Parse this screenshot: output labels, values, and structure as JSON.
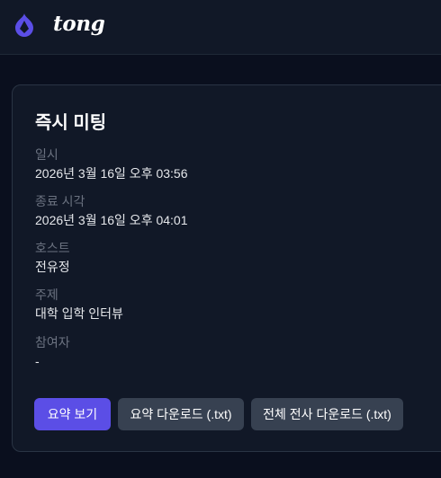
{
  "header": {
    "brand": "tong",
    "logo_color": "#5b4ee6"
  },
  "meeting": {
    "title": "즉시 미팅",
    "fields": [
      {
        "label": "일시",
        "value": "2026년 3월 16일 오후 03:56"
      },
      {
        "label": "종료 시각",
        "value": "2026년 3월 16일 오후 04:01"
      },
      {
        "label": "호스트",
        "value": "전유정"
      },
      {
        "label": "주제",
        "value": "대학 입학 인터뷰"
      },
      {
        "label": "참여자",
        "value": "-"
      }
    ],
    "actions": {
      "view_summary": "요약 보기",
      "download_summary": "요약 다운로드 (.txt)",
      "download_transcript": "전체 전사 다운로드 (.txt)"
    }
  }
}
